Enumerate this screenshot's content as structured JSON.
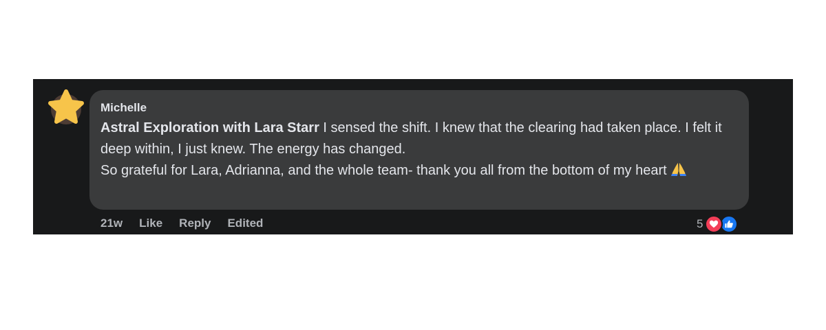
{
  "comment": {
    "author": "Michelle",
    "tagged_page": "Astral Exploration with Lara Starr",
    "body_line1": " I sensed the shift. I knew that the clearing had taken place. I felt it deep within, I just knew. The energy has changed.",
    "body_line2": "So grateful for Lara, Adrianna, and the whole team- thank you all from the bottom of my heart ",
    "emoji": "folded-hands-icon"
  },
  "actions": {
    "time": "21w",
    "like": "Like",
    "reply": "Reply",
    "edited": "Edited"
  },
  "reactions": {
    "count": "5",
    "types": [
      "love-reaction-icon",
      "like-reaction-icon"
    ]
  },
  "colors": {
    "background": "#18191a",
    "bubble": "#3a3b3c",
    "text": "#e4e6eb",
    "secondary_text": "#b0b3b8",
    "love": "#f33e58",
    "like": "#1877f2"
  }
}
